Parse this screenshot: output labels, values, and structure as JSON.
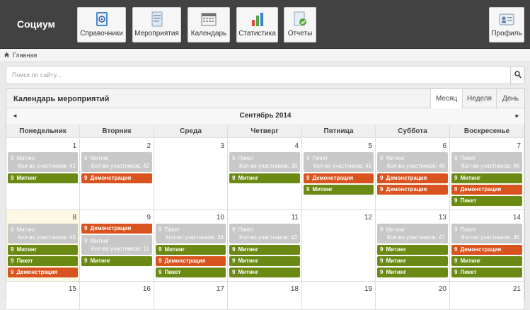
{
  "header": {
    "brand": "Социум",
    "nav": [
      {
        "label": "Справочники",
        "icon": "address-book-icon"
      },
      {
        "label": "Мероприятия",
        "icon": "document-icon"
      },
      {
        "label": "Календарь",
        "icon": "calendar-icon"
      },
      {
        "label": "Статистика",
        "icon": "bar-chart-icon"
      },
      {
        "label": "Отчеты",
        "icon": "report-check-icon"
      }
    ],
    "profile": {
      "label": "Профиль",
      "icon": "id-card-icon"
    }
  },
  "breadcrumb": {
    "home": "Главная"
  },
  "search": {
    "placeholder": "Поиск по сайту..."
  },
  "calendar": {
    "title": "Календарь мероприятий",
    "views": [
      "Месяц",
      "Неделя",
      "День"
    ],
    "active_view": "Месяц",
    "month": "Сентябрь 2014",
    "prev": "◄",
    "next": "►",
    "weekdays": [
      "Понедельник",
      "Вторник",
      "Среда",
      "Четверг",
      "Пятница",
      "Суббота",
      "Воскресенье"
    ],
    "weeks": [
      [
        {
          "day": "1",
          "events": [
            {
              "type": "grey",
              "time": "9",
              "title": "Митинг",
              "sub": "Кол-во участников: 42"
            },
            {
              "type": "green",
              "time": "9",
              "title": "Митинг"
            }
          ]
        },
        {
          "day": "2",
          "events": [
            {
              "type": "grey",
              "time": "9",
              "title": "Митинг",
              "sub": "Кол-во участников: 42"
            },
            {
              "type": "orange",
              "time": "9",
              "title": "Демонстрация"
            }
          ]
        },
        {
          "day": "3",
          "events": []
        },
        {
          "day": "4",
          "events": [
            {
              "type": "grey",
              "time": "9",
              "title": "Пикет",
              "sub": "Кол-во участников: 38"
            },
            {
              "type": "green",
              "time": "9",
              "title": "Митинг"
            }
          ]
        },
        {
          "day": "5",
          "events": [
            {
              "type": "grey",
              "time": "9",
              "title": "Пикет",
              "sub": "Кол-во участников: 43"
            },
            {
              "type": "orange",
              "time": "9",
              "title": "Демонстрация"
            },
            {
              "type": "green",
              "time": "9",
              "title": "Митинг"
            }
          ]
        },
        {
          "day": "6",
          "events": [
            {
              "type": "grey",
              "time": "9",
              "title": "Митинг",
              "sub": "Кол-во участников: 40"
            },
            {
              "type": "orange",
              "time": "9",
              "title": "Демонстрация"
            },
            {
              "type": "orange",
              "time": "9",
              "title": "Демонстрация"
            }
          ]
        },
        {
          "day": "7",
          "events": [
            {
              "type": "grey",
              "time": "9",
              "title": "Пикет",
              "sub": "Кол-во участников: 46"
            },
            {
              "type": "green",
              "time": "9",
              "title": "Митинг"
            },
            {
              "type": "orange",
              "time": "9",
              "title": "Демонстрация"
            },
            {
              "type": "green",
              "time": "9",
              "title": "Пикет"
            }
          ]
        }
      ],
      [
        {
          "day": "8",
          "today": true,
          "events": [
            {
              "type": "grey",
              "time": "9",
              "title": "Митинг",
              "sub": "Кол-во участников: 45"
            },
            {
              "type": "green",
              "time": "9",
              "title": "Митинг"
            },
            {
              "type": "green",
              "time": "9",
              "title": "Пикет"
            },
            {
              "type": "orange",
              "time": "9",
              "title": "Демонстрация"
            }
          ]
        },
        {
          "day": "9",
          "events": [
            {
              "type": "orange",
              "time": "9",
              "title": "Демонстрация"
            },
            {
              "type": "grey",
              "time": "9",
              "title": "Митинг",
              "sub": "Кол-во участников: 11"
            },
            {
              "type": "green",
              "time": "9",
              "title": "Митинг"
            }
          ]
        },
        {
          "day": "10",
          "events": [
            {
              "type": "grey",
              "time": "9",
              "title": "Пикет",
              "sub": "Кол-во участников: 34"
            },
            {
              "type": "green",
              "time": "9",
              "title": "Митинг"
            },
            {
              "type": "orange",
              "time": "9",
              "title": "Демонстрация"
            },
            {
              "type": "green",
              "time": "9",
              "title": "Пикет"
            }
          ]
        },
        {
          "day": "11",
          "events": [
            {
              "type": "grey",
              "time": "9",
              "title": "Пикет",
              "sub": "Кол-во участников: 43"
            },
            {
              "type": "green",
              "time": "9",
              "title": "Митинг"
            },
            {
              "type": "green",
              "time": "9",
              "title": "Митинг"
            },
            {
              "type": "green",
              "time": "9",
              "title": "Митинг"
            }
          ]
        },
        {
          "day": "12",
          "events": []
        },
        {
          "day": "13",
          "events": [
            {
              "type": "grey",
              "time": "9",
              "title": "Митинг",
              "sub": "Кол-во участников: 47"
            },
            {
              "type": "green",
              "time": "9",
              "title": "Митинг"
            },
            {
              "type": "green",
              "time": "9",
              "title": "Митинг"
            },
            {
              "type": "green",
              "time": "9",
              "title": "Митинг"
            }
          ]
        },
        {
          "day": "14",
          "events": [
            {
              "type": "grey",
              "time": "9",
              "title": "Пикет",
              "sub": "Кол-во участников: 36"
            },
            {
              "type": "orange",
              "time": "9",
              "title": "Демонстрация"
            },
            {
              "type": "green",
              "time": "9",
              "title": "Митинг"
            },
            {
              "type": "green",
              "time": "9",
              "title": "Пикет"
            }
          ]
        }
      ],
      [
        {
          "day": "15",
          "events": []
        },
        {
          "day": "16",
          "events": []
        },
        {
          "day": "17",
          "events": []
        },
        {
          "day": "18",
          "events": []
        },
        {
          "day": "19",
          "events": []
        },
        {
          "day": "20",
          "events": []
        },
        {
          "day": "21",
          "events": []
        }
      ]
    ]
  },
  "colors": {
    "green": "#6b8a14",
    "orange": "#d9531e",
    "grey": "#c8c8c8",
    "topbar": "#424242"
  }
}
